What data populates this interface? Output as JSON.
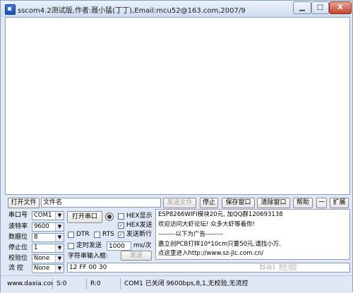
{
  "window": {
    "title": "sscom4.2测试版,作者:聂小猛(丁丁),Email:mcu52@163.com,2007/9",
    "min_label": "▁",
    "max_label": "□",
    "close_label": "X"
  },
  "file_row": {
    "open_file": "打开文件",
    "filename_label": "文件名",
    "send_file": "发送文件",
    "stop": "停止",
    "save_window": "保存窗口",
    "clear_window": "清除窗口",
    "help": "帮助",
    "dash": "一",
    "expand": "扩展"
  },
  "serial": {
    "port_label": "串口号",
    "port_value": "COM1",
    "open_port_button": "打开串口",
    "baud_label": "波特率",
    "baud_value": "9600",
    "databits_label": "数据位",
    "databits_value": "8",
    "stopbits_label": "停止位",
    "stopbits_value": "1",
    "parity_label": "校验位",
    "parity_value": "None",
    "flow_label": "流 控",
    "flow_value": "None"
  },
  "options": {
    "hex_display": "HEX显示",
    "hex_send": "HEX发送",
    "send_newline": "发送新行",
    "dtr": "DTR",
    "rts": "RTS",
    "timed_send": "定时发送",
    "interval_value": "1000",
    "interval_unit": "ms/次",
    "string_input": "字符串输入框:",
    "send_button": "发送",
    "send_text": "12 FF 00 30"
  },
  "info": {
    "lines": [
      "ESP8266WIFI模块20元, 加QQ群120693138",
      "欢迎访问大虾论坛! 众多大虾等着你!",
      "--------以下为广告--------",
      "嘉立创PCB打样10*10cm只要50元,请找小万.",
      "点这里进入http://www.sz-jlc.com.cn/"
    ]
  },
  "status": {
    "site": "www.daxia.com",
    "s_count": "S:0",
    "r_count": "R:0",
    "port_state": "COM1 已关闭  9600bps,8,1,无校验,无流控"
  },
  "watermark": "Bai 经验"
}
